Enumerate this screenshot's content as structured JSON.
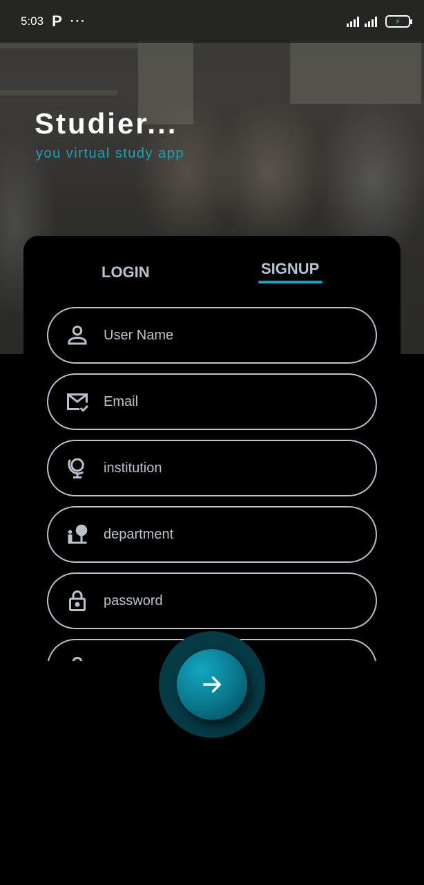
{
  "status_bar": {
    "time": "5:03",
    "app_letter": "P",
    "more": "···"
  },
  "brand": {
    "title": "Studier...",
    "subtitle": "you virtual study app"
  },
  "tabs": {
    "login": "LOGIN",
    "signup": "SIGNUP",
    "active": "signup"
  },
  "form": {
    "fields": [
      {
        "icon": "user-icon",
        "placeholder": "User Name"
      },
      {
        "icon": "email-check-icon",
        "placeholder": "Email"
      },
      {
        "icon": "globe-icon",
        "placeholder": "institution"
      },
      {
        "icon": "department-icon",
        "placeholder": "department"
      },
      {
        "icon": "lock-icon",
        "placeholder": "password"
      },
      {
        "icon": "lock-icon",
        "placeholder": ""
      }
    ]
  },
  "submit": {
    "icon": "arrow-right-icon"
  },
  "colors": {
    "accent": "#18a2bf",
    "field_border": "#b9c3cc",
    "background": "#000000"
  }
}
